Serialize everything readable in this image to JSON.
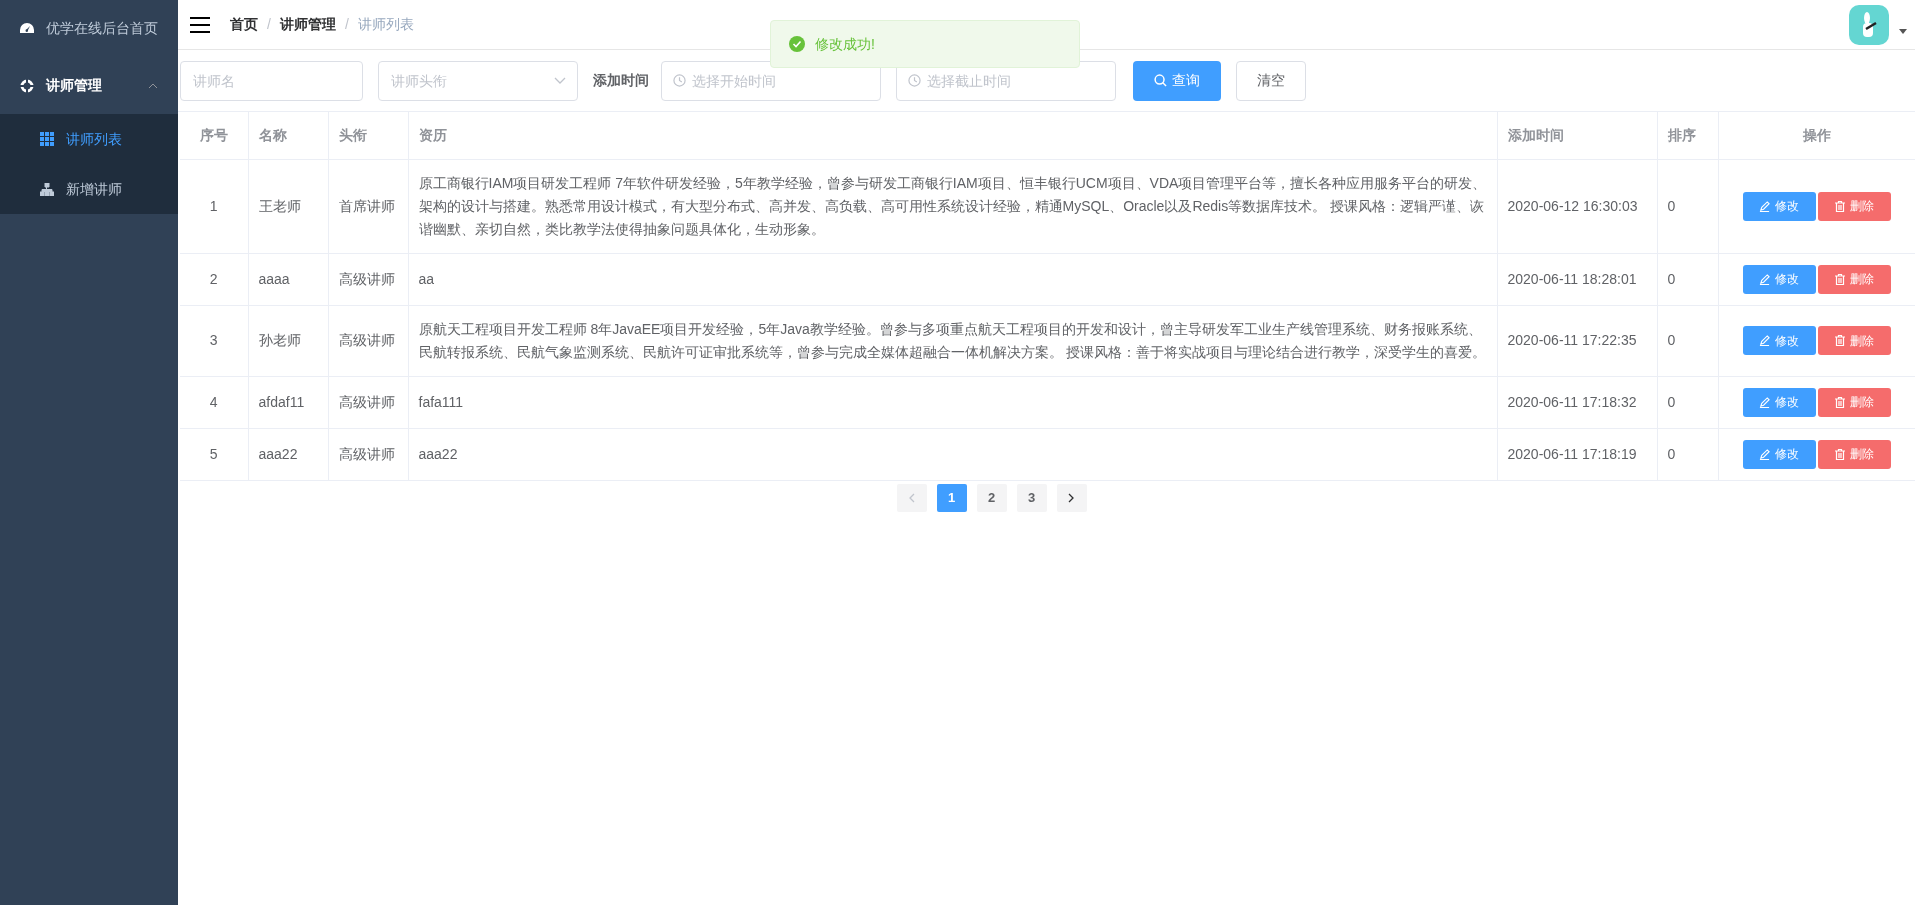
{
  "sidebar": {
    "items": [
      {
        "label": "优学在线后台首页",
        "selected": false
      },
      {
        "label": "讲师管理",
        "expanded": true,
        "children": [
          {
            "label": "讲师列表",
            "selected": true
          },
          {
            "label": "新增讲师",
            "selected": false
          }
        ]
      }
    ]
  },
  "breadcrumb": [
    {
      "label": "首页",
      "current": false
    },
    {
      "separator": "/",
      "label": "讲师管理",
      "current": false
    },
    {
      "separator": "/",
      "label": "讲师列表",
      "current": true
    }
  ],
  "toast": {
    "kind": "success",
    "message": "修改成功!"
  },
  "filters": {
    "name": {
      "placeholder": "讲师名"
    },
    "title": {
      "placeholder": "讲师头衔"
    },
    "date_label": "添加时间",
    "start": {
      "placeholder": "选择开始时间"
    },
    "end": {
      "placeholder": "选择截止时间"
    },
    "buttons": [
      {
        "label": "查询",
        "kind": "primary"
      },
      {
        "label": "清空",
        "kind": "plain"
      }
    ]
  },
  "table": {
    "columns": [
      "序号",
      "名称",
      "头衔",
      "资历",
      "添加时间",
      "排序",
      "操作"
    ],
    "rows": [
      {
        "cells": [
          "1",
          "王老师",
          "首席讲师",
          "原工商银行IAM项目研发工程师 7年软件研发经验，5年教学经验，曾参与研发工商银行IAM项目、恒丰银行UCM项目、VDA项目管理平台等，擅长各种应用服务平台的研发、架构的设计与搭建。熟悉常用设计模式，有大型分布式、高并发、高负载、高可用性系统设计经验，精通MySQL、Oracle以及Redis等数据库技术。 授课风格：逻辑严谨、诙谐幽默、亲切自然，类比教学法使得抽象问题具体化，生动形象。",
          "2020-06-12 16:30:03",
          "0"
        ],
        "actions": [
          {
            "kind": "edit",
            "label": "修改"
          },
          {
            "kind": "delete",
            "label": "删除"
          }
        ]
      },
      {
        "cells": [
          "2",
          "aaaa",
          "高级讲师",
          "aa",
          "2020-06-11 18:28:01",
          "0"
        ],
        "actions": [
          {
            "kind": "edit",
            "label": "修改"
          },
          {
            "kind": "delete",
            "label": "删除"
          }
        ]
      },
      {
        "cells": [
          "3",
          "孙老师",
          "高级讲师",
          "原航天工程项目开发工程师 8年JavaEE项目开发经验，5年Java教学经验。曾参与多项重点航天工程项目的开发和设计，曾主导研发军工业生产线管理系统、财务报账系统、民航转报系统、民航气象监测系统、民航许可证审批系统等，曾参与完成全媒体超融合一体机解决方案。 授课风格：善于将实战项目与理论结合进行教学，深受学生的喜爱。",
          "2020-06-11 17:22:35",
          "0"
        ],
        "actions": [
          {
            "kind": "edit",
            "label": "修改"
          },
          {
            "kind": "delete",
            "label": "删除"
          }
        ]
      },
      {
        "cells": [
          "4",
          "afdaf11",
          "高级讲师",
          "fafa111",
          "2020-06-11 17:18:32",
          "0"
        ],
        "actions": [
          {
            "kind": "edit",
            "label": "修改"
          },
          {
            "kind": "delete",
            "label": "删除"
          }
        ]
      },
      {
        "cells": [
          "5",
          "aaa22",
          "高级讲师",
          "aaa22",
          "2020-06-11 17:18:19",
          "0"
        ],
        "actions": [
          {
            "kind": "edit",
            "label": "修改"
          },
          {
            "kind": "delete",
            "label": "删除"
          }
        ]
      }
    ]
  },
  "pagination": {
    "pages": [
      {
        "label": "1",
        "selected": true
      },
      {
        "label": "2",
        "selected": false
      },
      {
        "label": "3",
        "selected": false
      }
    ]
  }
}
